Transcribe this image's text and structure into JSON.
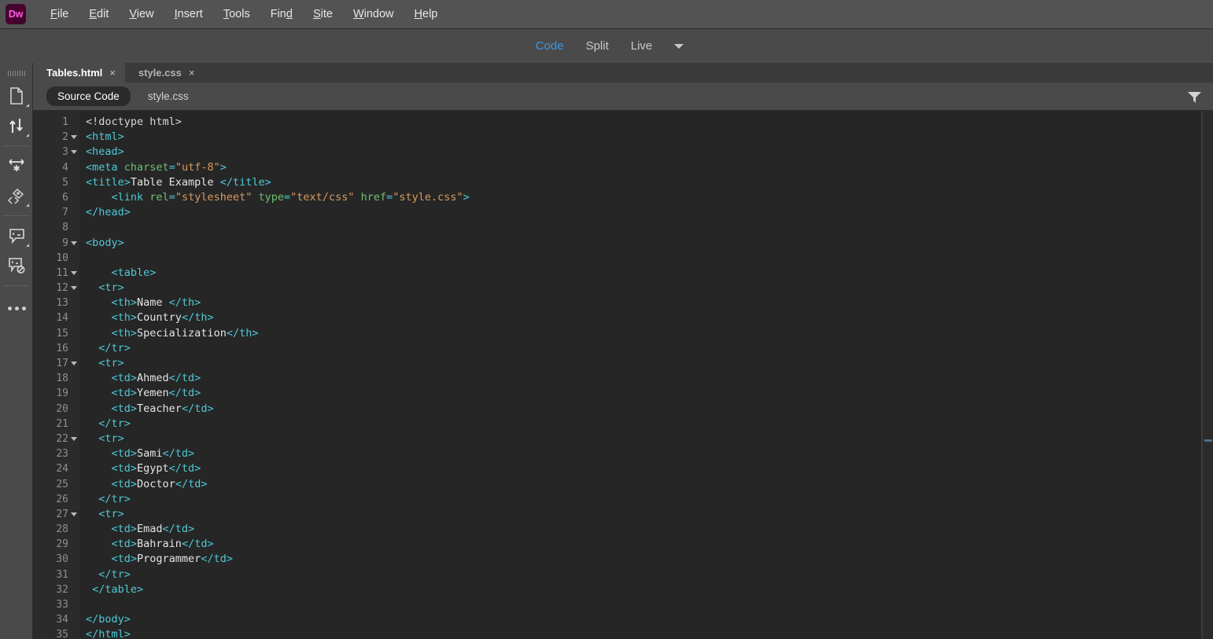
{
  "app": {
    "logo_text": "Dw",
    "logo_color": "#ff5ce0"
  },
  "menubar": {
    "items": [
      {
        "label": "File",
        "mnemonic": "F"
      },
      {
        "label": "Edit",
        "mnemonic": "E"
      },
      {
        "label": "View",
        "mnemonic": "V"
      },
      {
        "label": "Insert",
        "mnemonic": "I"
      },
      {
        "label": "Tools",
        "mnemonic": "T"
      },
      {
        "label": "Find",
        "mnemonic": "d"
      },
      {
        "label": "Site",
        "mnemonic": "S"
      },
      {
        "label": "Window",
        "mnemonic": "W"
      },
      {
        "label": "Help",
        "mnemonic": "H"
      }
    ]
  },
  "viewbar": {
    "buttons": [
      {
        "label": "Code",
        "active": true
      },
      {
        "label": "Split",
        "active": false
      },
      {
        "label": "Live",
        "active": false
      }
    ],
    "active_color": "#3f96e8",
    "caret": "chevron-down-icon"
  },
  "rail": {
    "icons": [
      {
        "name": "file-page-icon"
      },
      {
        "name": "sort-arrows-icon"
      },
      {
        "name": "resize-arrows-icon"
      },
      {
        "name": "code-wand-icon"
      },
      {
        "name": "comment-icon"
      },
      {
        "name": "comment-disabled-icon"
      },
      {
        "name": "more-options-icon"
      }
    ]
  },
  "tabs": [
    {
      "label": "Tables.html",
      "close": "×",
      "active": true
    },
    {
      "label": "style.css",
      "close": "×",
      "active": false
    }
  ],
  "source_bar": {
    "source_code_label": "Source Code",
    "stylesheet_label": "style.css",
    "filter_icon": "filter-funnel-icon"
  },
  "code": {
    "language": "html",
    "lines": [
      {
        "n": 1,
        "fold": false,
        "indent": 0,
        "tokens": [
          {
            "t": "dt",
            "v": "<!doctype html>"
          }
        ]
      },
      {
        "n": 2,
        "fold": true,
        "indent": 0,
        "tokens": [
          {
            "t": "tg",
            "v": "<html>"
          }
        ]
      },
      {
        "n": 3,
        "fold": true,
        "indent": 0,
        "tokens": [
          {
            "t": "tg",
            "v": "<head>"
          }
        ]
      },
      {
        "n": 4,
        "fold": false,
        "indent": 0,
        "tokens": [
          {
            "t": "tg",
            "v": "<meta "
          },
          {
            "t": "at",
            "v": "charset"
          },
          {
            "t": "tg",
            "v": "="
          },
          {
            "t": "va",
            "v": "\"utf-8\""
          },
          {
            "t": "tg",
            "v": ">"
          }
        ]
      },
      {
        "n": 5,
        "fold": false,
        "indent": 0,
        "tokens": [
          {
            "t": "tg",
            "v": "<title>"
          },
          {
            "t": "tx",
            "v": "Table Example "
          },
          {
            "t": "tg",
            "v": "</title>"
          }
        ]
      },
      {
        "n": 6,
        "fold": false,
        "indent": 4,
        "tokens": [
          {
            "t": "tg",
            "v": "<link "
          },
          {
            "t": "at",
            "v": "rel"
          },
          {
            "t": "tg",
            "v": "="
          },
          {
            "t": "va",
            "v": "\"stylesheet\""
          },
          {
            "t": "tg",
            "v": " "
          },
          {
            "t": "at",
            "v": "type"
          },
          {
            "t": "tg",
            "v": "="
          },
          {
            "t": "va",
            "v": "\"text/css\""
          },
          {
            "t": "tg",
            "v": " "
          },
          {
            "t": "at",
            "v": "href"
          },
          {
            "t": "tg",
            "v": "="
          },
          {
            "t": "va",
            "v": "\"style.css\""
          },
          {
            "t": "tg",
            "v": ">"
          }
        ]
      },
      {
        "n": 7,
        "fold": false,
        "indent": 0,
        "tokens": [
          {
            "t": "tg",
            "v": "</head>"
          }
        ]
      },
      {
        "n": 8,
        "fold": false,
        "indent": 0,
        "tokens": []
      },
      {
        "n": 9,
        "fold": true,
        "indent": 0,
        "tokens": [
          {
            "t": "tg",
            "v": "<body>"
          }
        ]
      },
      {
        "n": 10,
        "fold": false,
        "indent": 0,
        "tokens": []
      },
      {
        "n": 11,
        "fold": true,
        "indent": 4,
        "tokens": [
          {
            "t": "tg",
            "v": "<table>"
          }
        ]
      },
      {
        "n": 12,
        "fold": true,
        "indent": 2,
        "tokens": [
          {
            "t": "tg",
            "v": "<tr>"
          }
        ]
      },
      {
        "n": 13,
        "fold": false,
        "indent": 4,
        "tokens": [
          {
            "t": "tg",
            "v": "<th>"
          },
          {
            "t": "tx",
            "v": "Name "
          },
          {
            "t": "tg",
            "v": "</th>"
          }
        ]
      },
      {
        "n": 14,
        "fold": false,
        "indent": 4,
        "tokens": [
          {
            "t": "tg",
            "v": "<th>"
          },
          {
            "t": "tx",
            "v": "Country"
          },
          {
            "t": "tg",
            "v": "</th>"
          }
        ]
      },
      {
        "n": 15,
        "fold": false,
        "indent": 4,
        "tokens": [
          {
            "t": "tg",
            "v": "<th>"
          },
          {
            "t": "tx",
            "v": "Specialization"
          },
          {
            "t": "tg",
            "v": "</th>"
          }
        ]
      },
      {
        "n": 16,
        "fold": false,
        "indent": 2,
        "tokens": [
          {
            "t": "tg",
            "v": "</tr>"
          }
        ]
      },
      {
        "n": 17,
        "fold": true,
        "indent": 2,
        "tokens": [
          {
            "t": "tg",
            "v": "<tr>"
          }
        ]
      },
      {
        "n": 18,
        "fold": false,
        "indent": 4,
        "tokens": [
          {
            "t": "tg",
            "v": "<td>"
          },
          {
            "t": "tx",
            "v": "Ahmed"
          },
          {
            "t": "tg",
            "v": "</td>"
          }
        ]
      },
      {
        "n": 19,
        "fold": false,
        "indent": 4,
        "tokens": [
          {
            "t": "tg",
            "v": "<td>"
          },
          {
            "t": "tx",
            "v": "Yemen"
          },
          {
            "t": "tg",
            "v": "</td>"
          }
        ]
      },
      {
        "n": 20,
        "fold": false,
        "indent": 4,
        "tokens": [
          {
            "t": "tg",
            "v": "<td>"
          },
          {
            "t": "tx",
            "v": "Teacher"
          },
          {
            "t": "tg",
            "v": "</td>"
          }
        ]
      },
      {
        "n": 21,
        "fold": false,
        "indent": 2,
        "tokens": [
          {
            "t": "tg",
            "v": "</tr>"
          }
        ]
      },
      {
        "n": 22,
        "fold": true,
        "indent": 2,
        "tokens": [
          {
            "t": "tg",
            "v": "<tr>"
          }
        ]
      },
      {
        "n": 23,
        "fold": false,
        "indent": 4,
        "tokens": [
          {
            "t": "tg",
            "v": "<td>"
          },
          {
            "t": "tx",
            "v": "Sami"
          },
          {
            "t": "tg",
            "v": "</td>"
          }
        ]
      },
      {
        "n": 24,
        "fold": false,
        "indent": 4,
        "tokens": [
          {
            "t": "tg",
            "v": "<td>"
          },
          {
            "t": "tx",
            "v": "Egypt"
          },
          {
            "t": "tg",
            "v": "</td>"
          }
        ]
      },
      {
        "n": 25,
        "fold": false,
        "indent": 4,
        "tokens": [
          {
            "t": "tg",
            "v": "<td>"
          },
          {
            "t": "tx",
            "v": "Doctor"
          },
          {
            "t": "tg",
            "v": "</td>"
          }
        ]
      },
      {
        "n": 26,
        "fold": false,
        "indent": 2,
        "tokens": [
          {
            "t": "tg",
            "v": "</tr>"
          }
        ]
      },
      {
        "n": 27,
        "fold": true,
        "indent": 2,
        "tokens": [
          {
            "t": "tg",
            "v": "<tr>"
          }
        ]
      },
      {
        "n": 28,
        "fold": false,
        "indent": 4,
        "tokens": [
          {
            "t": "tg",
            "v": "<td>"
          },
          {
            "t": "tx",
            "v": "Emad"
          },
          {
            "t": "tg",
            "v": "</td>"
          }
        ]
      },
      {
        "n": 29,
        "fold": false,
        "indent": 4,
        "tokens": [
          {
            "t": "tg",
            "v": "<td>"
          },
          {
            "t": "tx",
            "v": "Bahrain"
          },
          {
            "t": "tg",
            "v": "</td>"
          }
        ]
      },
      {
        "n": 30,
        "fold": false,
        "indent": 4,
        "tokens": [
          {
            "t": "tg",
            "v": "<td>"
          },
          {
            "t": "tx",
            "v": "Programmer"
          },
          {
            "t": "tg",
            "v": "</td>"
          }
        ]
      },
      {
        "n": 31,
        "fold": false,
        "indent": 2,
        "tokens": [
          {
            "t": "tg",
            "v": "</tr>"
          }
        ]
      },
      {
        "n": 32,
        "fold": false,
        "indent": 1,
        "tokens": [
          {
            "t": "tg",
            "v": "</table>"
          }
        ]
      },
      {
        "n": 33,
        "fold": false,
        "indent": 0,
        "tokens": []
      },
      {
        "n": 34,
        "fold": false,
        "indent": 0,
        "tokens": [
          {
            "t": "tg",
            "v": "</body>"
          }
        ]
      },
      {
        "n": 35,
        "fold": false,
        "indent": 0,
        "tokens": [
          {
            "t": "tg",
            "v": "</html>"
          }
        ]
      }
    ],
    "colors": {
      "tag": "#4ec9d6",
      "attribute": "#6fbf6f",
      "value": "#d79a5e",
      "text": "#e4e4e4",
      "line_number": "#8f8f8f",
      "background": "#262626"
    }
  }
}
